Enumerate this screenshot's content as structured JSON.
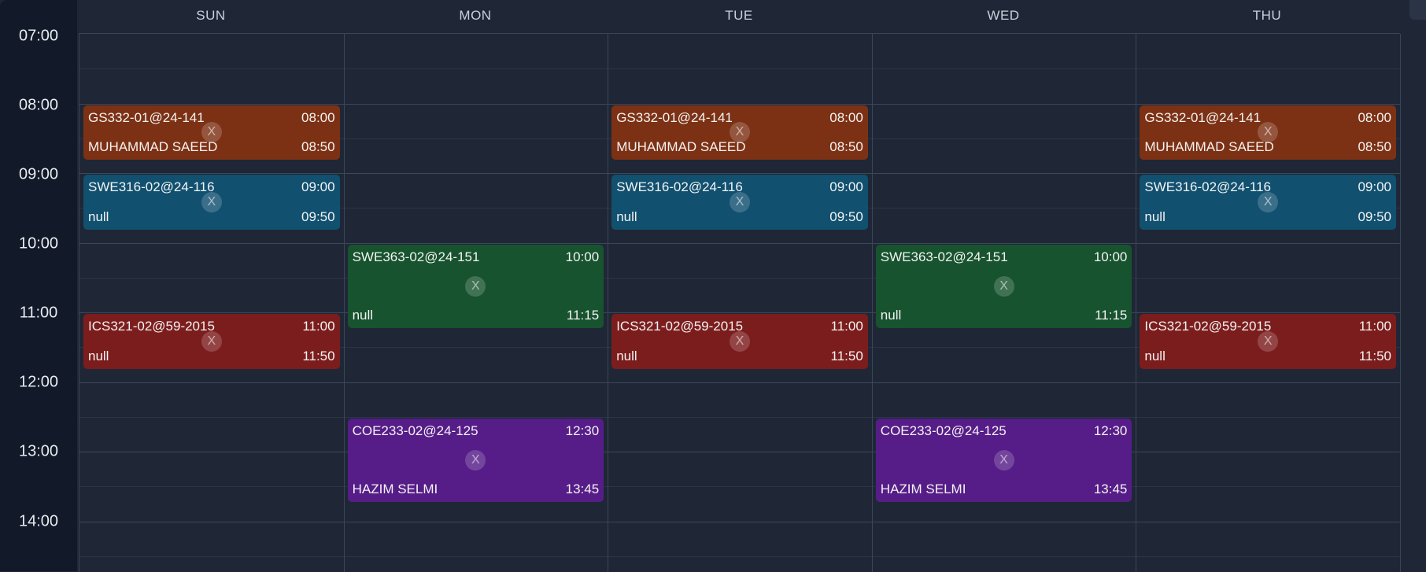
{
  "days": [
    "SUN",
    "MON",
    "TUE",
    "WED",
    "THU"
  ],
  "times": [
    "07:00",
    "08:00",
    "09:00",
    "10:00",
    "11:00",
    "12:00",
    "13:00",
    "14:00"
  ],
  "events": [
    {
      "day": 0,
      "code": "GS332-01@24-141",
      "instructor": "MUHAMMAD SAEED",
      "start": "08:00",
      "end": "08:50",
      "color": "#7d3114"
    },
    {
      "day": 2,
      "code": "GS332-01@24-141",
      "instructor": "MUHAMMAD SAEED",
      "start": "08:00",
      "end": "08:50",
      "color": "#7d3114"
    },
    {
      "day": 4,
      "code": "GS332-01@24-141",
      "instructor": "MUHAMMAD SAEED",
      "start": "08:00",
      "end": "08:50",
      "color": "#7d3114"
    },
    {
      "day": 0,
      "code": "SWE316-02@24-116",
      "instructor": "null",
      "start": "09:00",
      "end": "09:50",
      "color": "#11506f"
    },
    {
      "day": 2,
      "code": "SWE316-02@24-116",
      "instructor": "null",
      "start": "09:00",
      "end": "09:50",
      "color": "#11506f"
    },
    {
      "day": 4,
      "code": "SWE316-02@24-116",
      "instructor": "null",
      "start": "09:00",
      "end": "09:50",
      "color": "#11506f"
    },
    {
      "day": 1,
      "code": "SWE363-02@24-151",
      "instructor": "null",
      "start": "10:00",
      "end": "11:15",
      "color": "#17532e"
    },
    {
      "day": 3,
      "code": "SWE363-02@24-151",
      "instructor": "null",
      "start": "10:00",
      "end": "11:15",
      "color": "#17532e"
    },
    {
      "day": 0,
      "code": "ICS321-02@59-2015",
      "instructor": "null",
      "start": "11:00",
      "end": "11:50",
      "color": "#7c1d1d"
    },
    {
      "day": 2,
      "code": "ICS321-02@59-2015",
      "instructor": "null",
      "start": "11:00",
      "end": "11:50",
      "color": "#7c1d1d"
    },
    {
      "day": 4,
      "code": "ICS321-02@59-2015",
      "instructor": "null",
      "start": "11:00",
      "end": "11:50",
      "color": "#7c1d1d"
    },
    {
      "day": 1,
      "code": "COE233-02@24-125",
      "instructor": "HAZIM SELMI",
      "start": "12:30",
      "end": "13:45",
      "color": "#561d88"
    },
    {
      "day": 3,
      "code": "COE233-02@24-125",
      "instructor": "HAZIM SELMI",
      "start": "12:30",
      "end": "13:45",
      "color": "#561d88"
    }
  ],
  "remove_label": "X",
  "icons": {
    "collapse": "chevron-down-icon"
  }
}
